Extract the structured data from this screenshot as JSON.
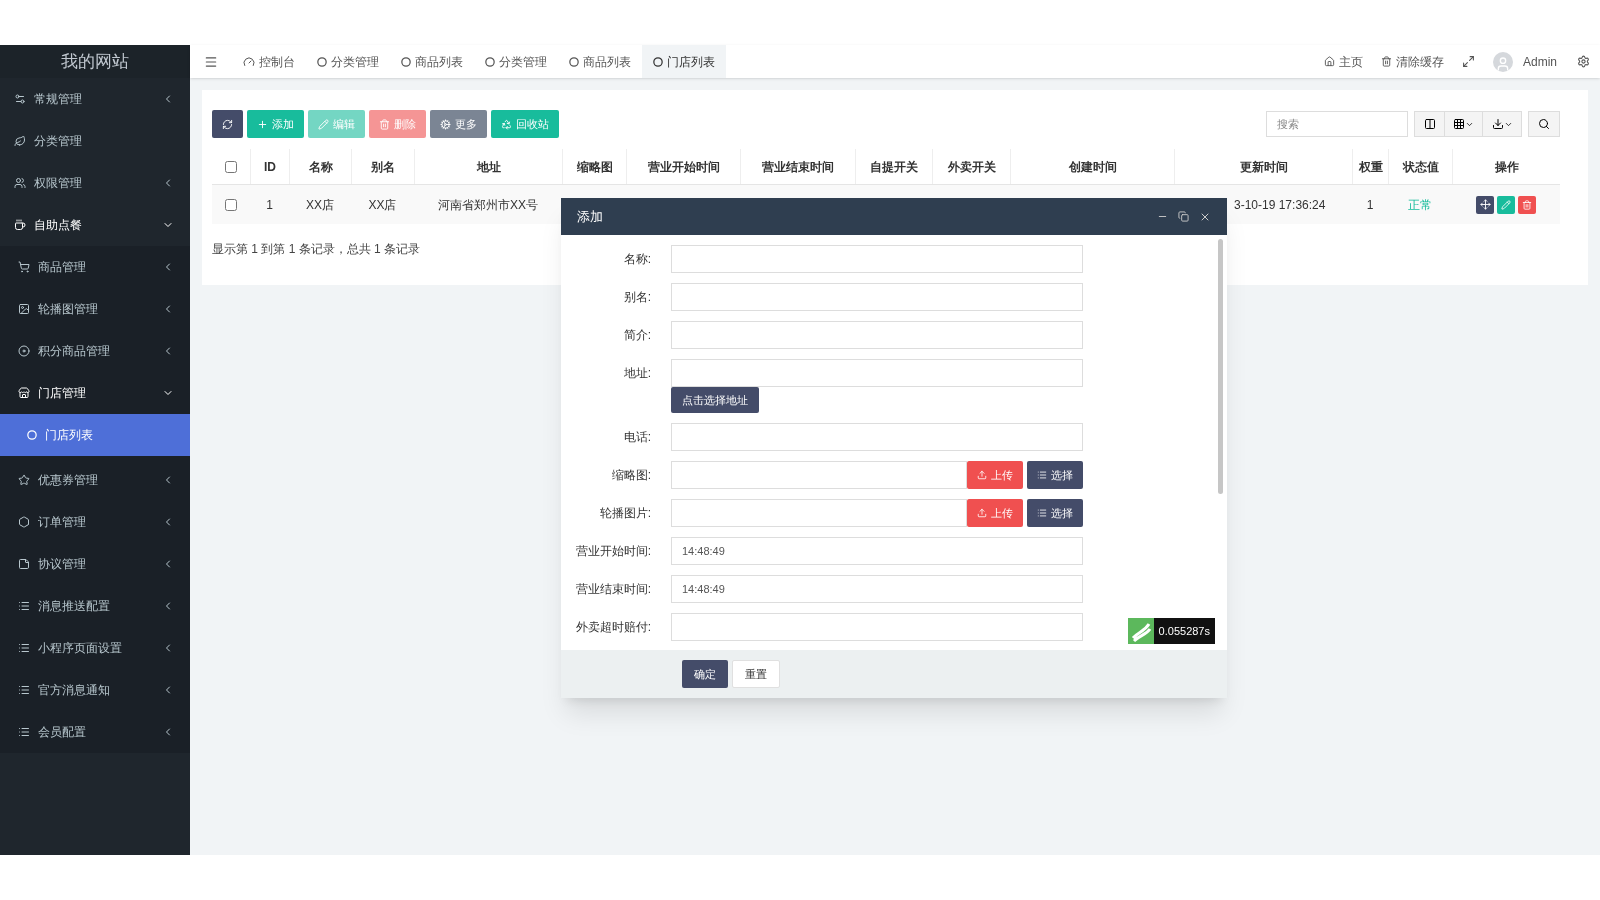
{
  "sidebar": {
    "title": "我的网站",
    "items": [
      {
        "label": "常规管理",
        "expanded": false
      },
      {
        "label": "分类管理"
      },
      {
        "label": "权限管理",
        "expanded": false
      },
      {
        "label": "自助点餐",
        "expanded": true,
        "children": [
          {
            "label": "商品管理",
            "expanded": false
          },
          {
            "label": "轮播图管理",
            "expanded": false
          },
          {
            "label": "积分商品管理",
            "expanded": false
          },
          {
            "label": "门店管理",
            "expanded": true,
            "children": [
              {
                "label": "门店列表",
                "selected": true
              }
            ]
          },
          {
            "label": "优惠券管理",
            "expanded": false
          },
          {
            "label": "订单管理",
            "expanded": false
          },
          {
            "label": "协议管理",
            "expanded": false
          },
          {
            "label": "消息推送配置",
            "expanded": false
          },
          {
            "label": "小程序页面设置",
            "expanded": false
          },
          {
            "label": "官方消息通知",
            "expanded": false
          },
          {
            "label": "会员配置",
            "expanded": false
          }
        ]
      }
    ]
  },
  "header": {
    "tabs": [
      {
        "label": "控制台",
        "kind": "dashboard",
        "selected": false
      },
      {
        "label": "分类管理",
        "kind": "page",
        "selected": false
      },
      {
        "label": "商品列表",
        "kind": "page",
        "selected": false
      },
      {
        "label": "分类管理",
        "kind": "page",
        "selected": false
      },
      {
        "label": "商品列表",
        "kind": "page",
        "selected": false
      },
      {
        "label": "门店列表",
        "kind": "page",
        "selected": true
      }
    ],
    "links": [
      "主页",
      "清除缓存"
    ],
    "user": "Admin"
  },
  "toolbar": {
    "buttons": [
      {
        "kind": "refresh",
        "disabled": false
      },
      {
        "kind": "add",
        "label": "添加",
        "disabled": false
      },
      {
        "kind": "edit",
        "label": "编辑",
        "disabled": true
      },
      {
        "kind": "delete",
        "label": "删除",
        "disabled": true
      },
      {
        "kind": "more",
        "label": "更多",
        "disabled": false
      },
      {
        "kind": "recycle",
        "label": "回收站",
        "disabled": false
      }
    ],
    "search": {
      "placeholder": "搜索"
    }
  },
  "table": {
    "columns": [
      "ID",
      "名称",
      "别名",
      "地址",
      "缩略图",
      "营业开始时间",
      "营业结束时间",
      "自提开关",
      "外卖开关",
      "创建时间",
      "更新时间",
      "权重",
      "状态值",
      "操作"
    ],
    "all_checked": false,
    "rows": [
      {
        "checked": false,
        "id": "1",
        "name": "XX店",
        "alias": "XX店",
        "address": "河南省郑州市XX号",
        "updated": "3-10-19 17:36:24",
        "weight": "1",
        "status": "正常"
      }
    ],
    "summary": "显示第 1 到第 1 条记录，总共 1 条记录"
  },
  "dialog": {
    "title": "添加",
    "fields": [
      {
        "kind": "text",
        "label": "名称:"
      },
      {
        "kind": "text",
        "label": "别名:"
      },
      {
        "kind": "text",
        "label": "简介:"
      },
      {
        "kind": "address",
        "label": "地址:",
        "button": "点击选择地址"
      },
      {
        "kind": "text",
        "label": "电话:"
      },
      {
        "kind": "upload",
        "label": "缩略图:",
        "upload": "上传",
        "choose": "选择"
      },
      {
        "kind": "upload",
        "label": "轮播图片:",
        "upload": "上传",
        "choose": "选择"
      },
      {
        "kind": "text",
        "label": "营业开始时间:",
        "value": "14:48:49"
      },
      {
        "kind": "text",
        "label": "营业结束时间:",
        "value": "14:48:49"
      },
      {
        "kind": "text",
        "label": "外卖超时赔付:"
      }
    ],
    "buttons": [
      "确定",
      "重置"
    ],
    "timing": "0.055287s"
  }
}
